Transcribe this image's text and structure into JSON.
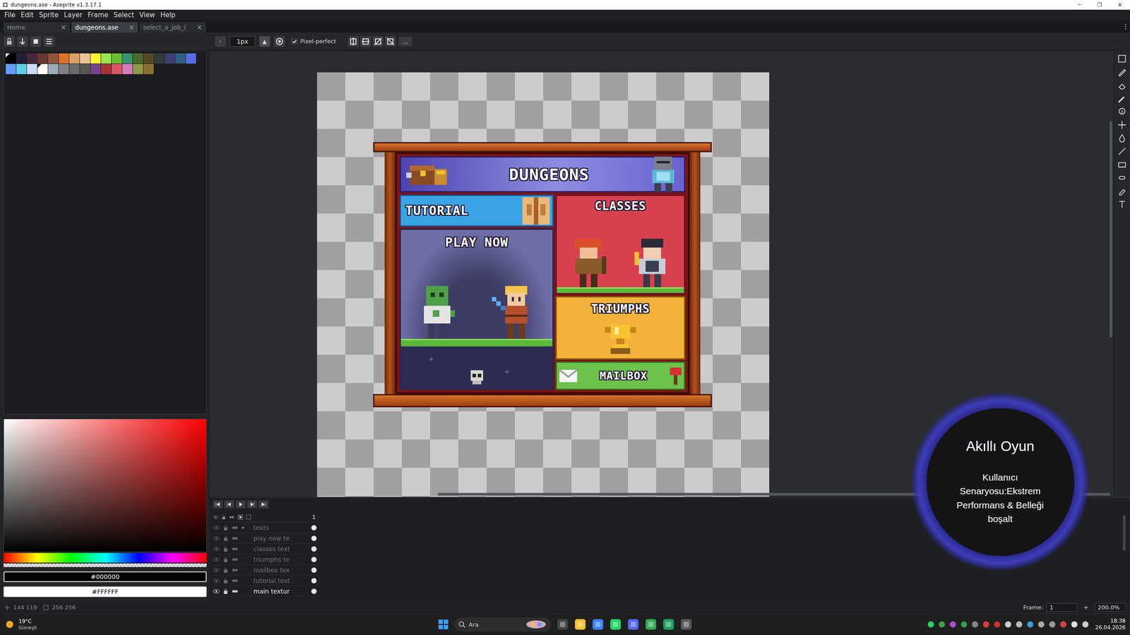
{
  "window": {
    "title": "dungeons.ase - Aseprite v1.3.17.1",
    "controls": [
      "─",
      "❐",
      "✕"
    ]
  },
  "menu": [
    "File",
    "Edit",
    "Sprite",
    "Layer",
    "Frame",
    "Select",
    "View",
    "Help"
  ],
  "tabs": [
    {
      "label": "Home",
      "selected": false
    },
    {
      "label": "dungeons.ase",
      "selected": true
    },
    {
      "label": "select_a_job_(",
      "selected": false
    }
  ],
  "tab_close": "×",
  "toolbar": {
    "brush_size": "1px",
    "pixel_perfect": {
      "label": "Pixel-perfect",
      "checked": true
    },
    "more": "..."
  },
  "palette": [
    {
      "color": "#000000",
      "selected": true
    },
    {
      "color": "#222034",
      "selected": false
    },
    {
      "color": "#45283c",
      "selected": false
    },
    {
      "color": "#663931",
      "selected": false
    },
    {
      "color": "#8f563b",
      "selected": false
    },
    {
      "color": "#df7126",
      "selected": false
    },
    {
      "color": "#d9a066",
      "selected": false
    },
    {
      "color": "#eec39a",
      "selected": false
    },
    {
      "color": "#fbf236",
      "selected": false
    },
    {
      "color": "#99e550",
      "selected": false
    },
    {
      "color": "#6abe30",
      "selected": false
    },
    {
      "color": "#37946e",
      "selected": false
    },
    {
      "color": "#4b692f",
      "selected": false
    },
    {
      "color": "#524b24",
      "selected": false
    },
    {
      "color": "#323c39",
      "selected": false
    },
    {
      "color": "#3f3f74",
      "selected": false
    },
    {
      "color": "#306082",
      "selected": false
    },
    {
      "color": "#5b6ee1",
      "selected": false
    },
    {
      "color": "#639bff",
      "selected": false
    },
    {
      "color": "#5fcde4",
      "selected": false
    },
    {
      "color": "#cbdbfc",
      "selected": false
    },
    {
      "color": "#ffffff",
      "selected": true
    },
    {
      "color": "#9badb7",
      "selected": false
    },
    {
      "color": "#847e87",
      "selected": false
    },
    {
      "color": "#696a6a",
      "selected": false
    },
    {
      "color": "#595652",
      "selected": false
    },
    {
      "color": "#76428a",
      "selected": false
    },
    {
      "color": "#ac3232",
      "selected": false
    },
    {
      "color": "#d95763",
      "selected": false
    },
    {
      "color": "#d77bba",
      "selected": false
    },
    {
      "color": "#8f974a",
      "selected": false
    },
    {
      "color": "#8a6f30",
      "selected": false
    }
  ],
  "colors": {
    "foreground": "#000000",
    "background": "#FFFFFF"
  },
  "sprite": {
    "banner": "DUNGEONS",
    "tutorial": "TUTORIAL",
    "play": "PLAY NOW",
    "classes": "CLASSES",
    "triumphs": "TRIUMPHS",
    "mailbox": "MAILBOX"
  },
  "timeline": {
    "frames": [
      "1"
    ],
    "layers": [
      {
        "name": "texts",
        "visible": false,
        "group": true
      },
      {
        "name": "play now te",
        "visible": false,
        "group": false
      },
      {
        "name": "classes text",
        "visible": false,
        "group": false
      },
      {
        "name": "triumphs te",
        "visible": false,
        "group": false
      },
      {
        "name": "mailbox tex",
        "visible": false,
        "group": false
      },
      {
        "name": "tutorial text",
        "visible": false,
        "group": false
      },
      {
        "name": "main textur",
        "visible": true,
        "group": false
      }
    ]
  },
  "status_bar": {
    "cursor": "144 119",
    "sprite_size": "256 256",
    "frame_label": "Frame:",
    "frame": "1",
    "frame_add": "+",
    "zoom": "200.0%"
  },
  "taskbar": {
    "weather": {
      "temp": "19°C",
      "desc": "Güneşli"
    },
    "search": "Ara",
    "time": "18:38",
    "date": "26.04.2026"
  },
  "overlay": {
    "title": "Akıllı Oyun",
    "lines": [
      "Kullanıcı",
      "Senaryosu:Ekstrem",
      "Performans & Belleği",
      "boşalt"
    ]
  }
}
